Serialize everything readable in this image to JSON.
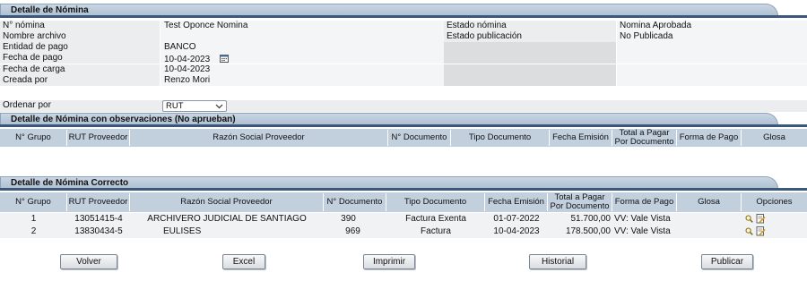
{
  "detail": {
    "title": "Detalle de Nómina",
    "left": [
      {
        "label": "N° nómina",
        "value": "Test Oponce Nomina"
      },
      {
        "label": "Nombre archivo",
        "value": ""
      },
      {
        "label": "Entidad de pago",
        "value": "BANCO"
      },
      {
        "label": "Fecha de pago",
        "value": "10-04-2023"
      },
      {
        "label": "Fecha de carga",
        "value": "10-04-2023"
      },
      {
        "label": "Creada por",
        "value": "Renzo Mori"
      }
    ],
    "right": [
      {
        "label": "Estado nómina",
        "value": "Nomina Aprobada"
      },
      {
        "label": "Estado publicación",
        "value": "No Publicada"
      }
    ]
  },
  "sort": {
    "label": "Ordenar por",
    "selected": "RUT"
  },
  "observations": {
    "title": "Detalle de Nómina con observaciones (No aprueban)",
    "headers": [
      "N° Grupo",
      "RUT Proveedor",
      "Razón Social Proveedor",
      "N° Documento",
      "Tipo Documento",
      "Fecha Emisión",
      "Total a Pagar Por Documento",
      "Forma de Pago",
      "Glosa"
    ]
  },
  "correct": {
    "title": "Detalle de Nómina Correcto",
    "headers": [
      "N° Grupo",
      "RUT Proveedor",
      "Razón Social Proveedor",
      "N° Documento",
      "Tipo Documento",
      "Fecha Emisión",
      "Total a Pagar Por Documento",
      "Forma de Pago",
      "Glosa",
      "Opciones"
    ],
    "rows": [
      {
        "grupo": "1",
        "rut": "13051415-4",
        "razon": "ARCHIVERO JUDICIAL DE SANTIAGO",
        "doc": "390",
        "tipo": "Factura Exenta",
        "fecha": "01-07-2022",
        "total": "51.700,00",
        "forma": "VV: Vale Vista",
        "glosa": ""
      },
      {
        "grupo": "2",
        "rut": "13830434-5",
        "razon": "EULISES",
        "doc": "969",
        "tipo": "Factura",
        "fecha": "10-04-2023",
        "total": "178.500,00",
        "forma": "VV: Vale Vista",
        "glosa": ""
      }
    ]
  },
  "buttons": {
    "back": "Volver",
    "excel": "Excel",
    "print": "Imprimir",
    "history": "Historial",
    "publish": "Publicar"
  },
  "icons": {
    "calendar": "calendar-icon",
    "view": "magnifier-icon",
    "edit": "document-edit-icon"
  },
  "colors": {
    "header_bar": "#3b587a",
    "tab": "#b9c9d9",
    "table_header": "#c2d0de"
  }
}
